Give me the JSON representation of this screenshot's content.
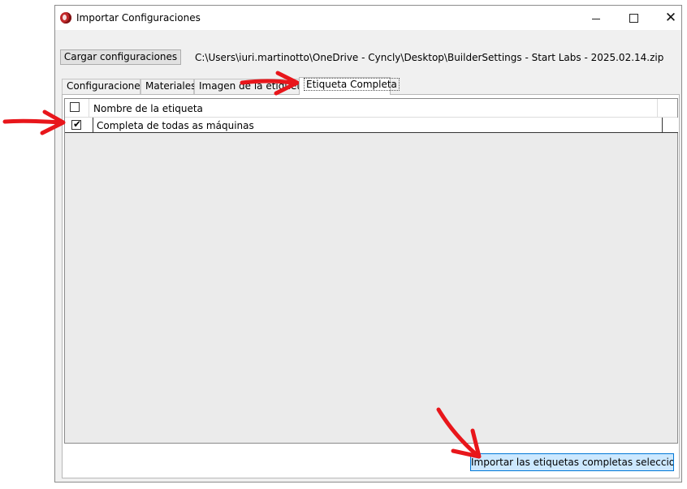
{
  "window": {
    "title": "Importar Configuraciones",
    "controls": {
      "minimize": "minimize-icon",
      "maximize": "maximize-icon",
      "close": "close-icon"
    }
  },
  "toolbar": {
    "load_button": "Cargar configuraciones",
    "file_path": "C:\\Users\\iuri.martinotto\\OneDrive - Cyncly\\Desktop\\BuilderSettings - Start Labs - 2025.02.14.zip"
  },
  "tabs": [
    {
      "label": "Configuraciones",
      "active": false
    },
    {
      "label": "Materiales",
      "active": false
    },
    {
      "label": "Imagen de la etiqueta",
      "active": false
    },
    {
      "label": "Etiqueta Completa",
      "active": true
    }
  ],
  "grid": {
    "header": {
      "column": "Nombre de la etiqueta",
      "select_all_checked": false
    },
    "rows": [
      {
        "label": "Completa de todas as máquinas",
        "checked": true
      }
    ]
  },
  "footer": {
    "import_button": "Importar las etiquetas completas seleccionadas"
  },
  "annotations": {
    "arrow_color": "#e8161b"
  },
  "colors": {
    "app_icon": "#c0282a",
    "selected_button_bg": "#cce8ff",
    "selected_button_border": "#0078d7"
  }
}
